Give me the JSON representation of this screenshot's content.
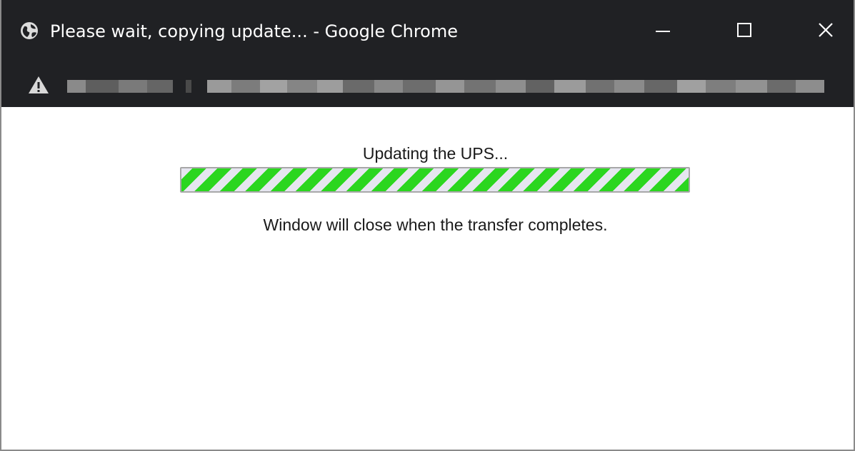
{
  "window": {
    "title": "Please wait, copying update... - Google Chrome",
    "app_icon": "globe-icon",
    "controls": {
      "minimize_icon": "minimize-icon",
      "maximize_icon": "maximize-icon",
      "close_icon": "close-icon"
    }
  },
  "address_bar": {
    "security_icon": "warning-triangle-icon",
    "url_obscured": true
  },
  "dialog": {
    "status_text": "Updating the UPS...",
    "progress": {
      "style": "indeterminate-striped",
      "stripe_color": "#2bd61f",
      "track_color": "#e6e6f0"
    },
    "note_text": "Window will close when the transfer completes."
  },
  "colors": {
    "titlebar_background": "#202124",
    "content_background": "#ffffff",
    "text": "#1a1a1a"
  }
}
